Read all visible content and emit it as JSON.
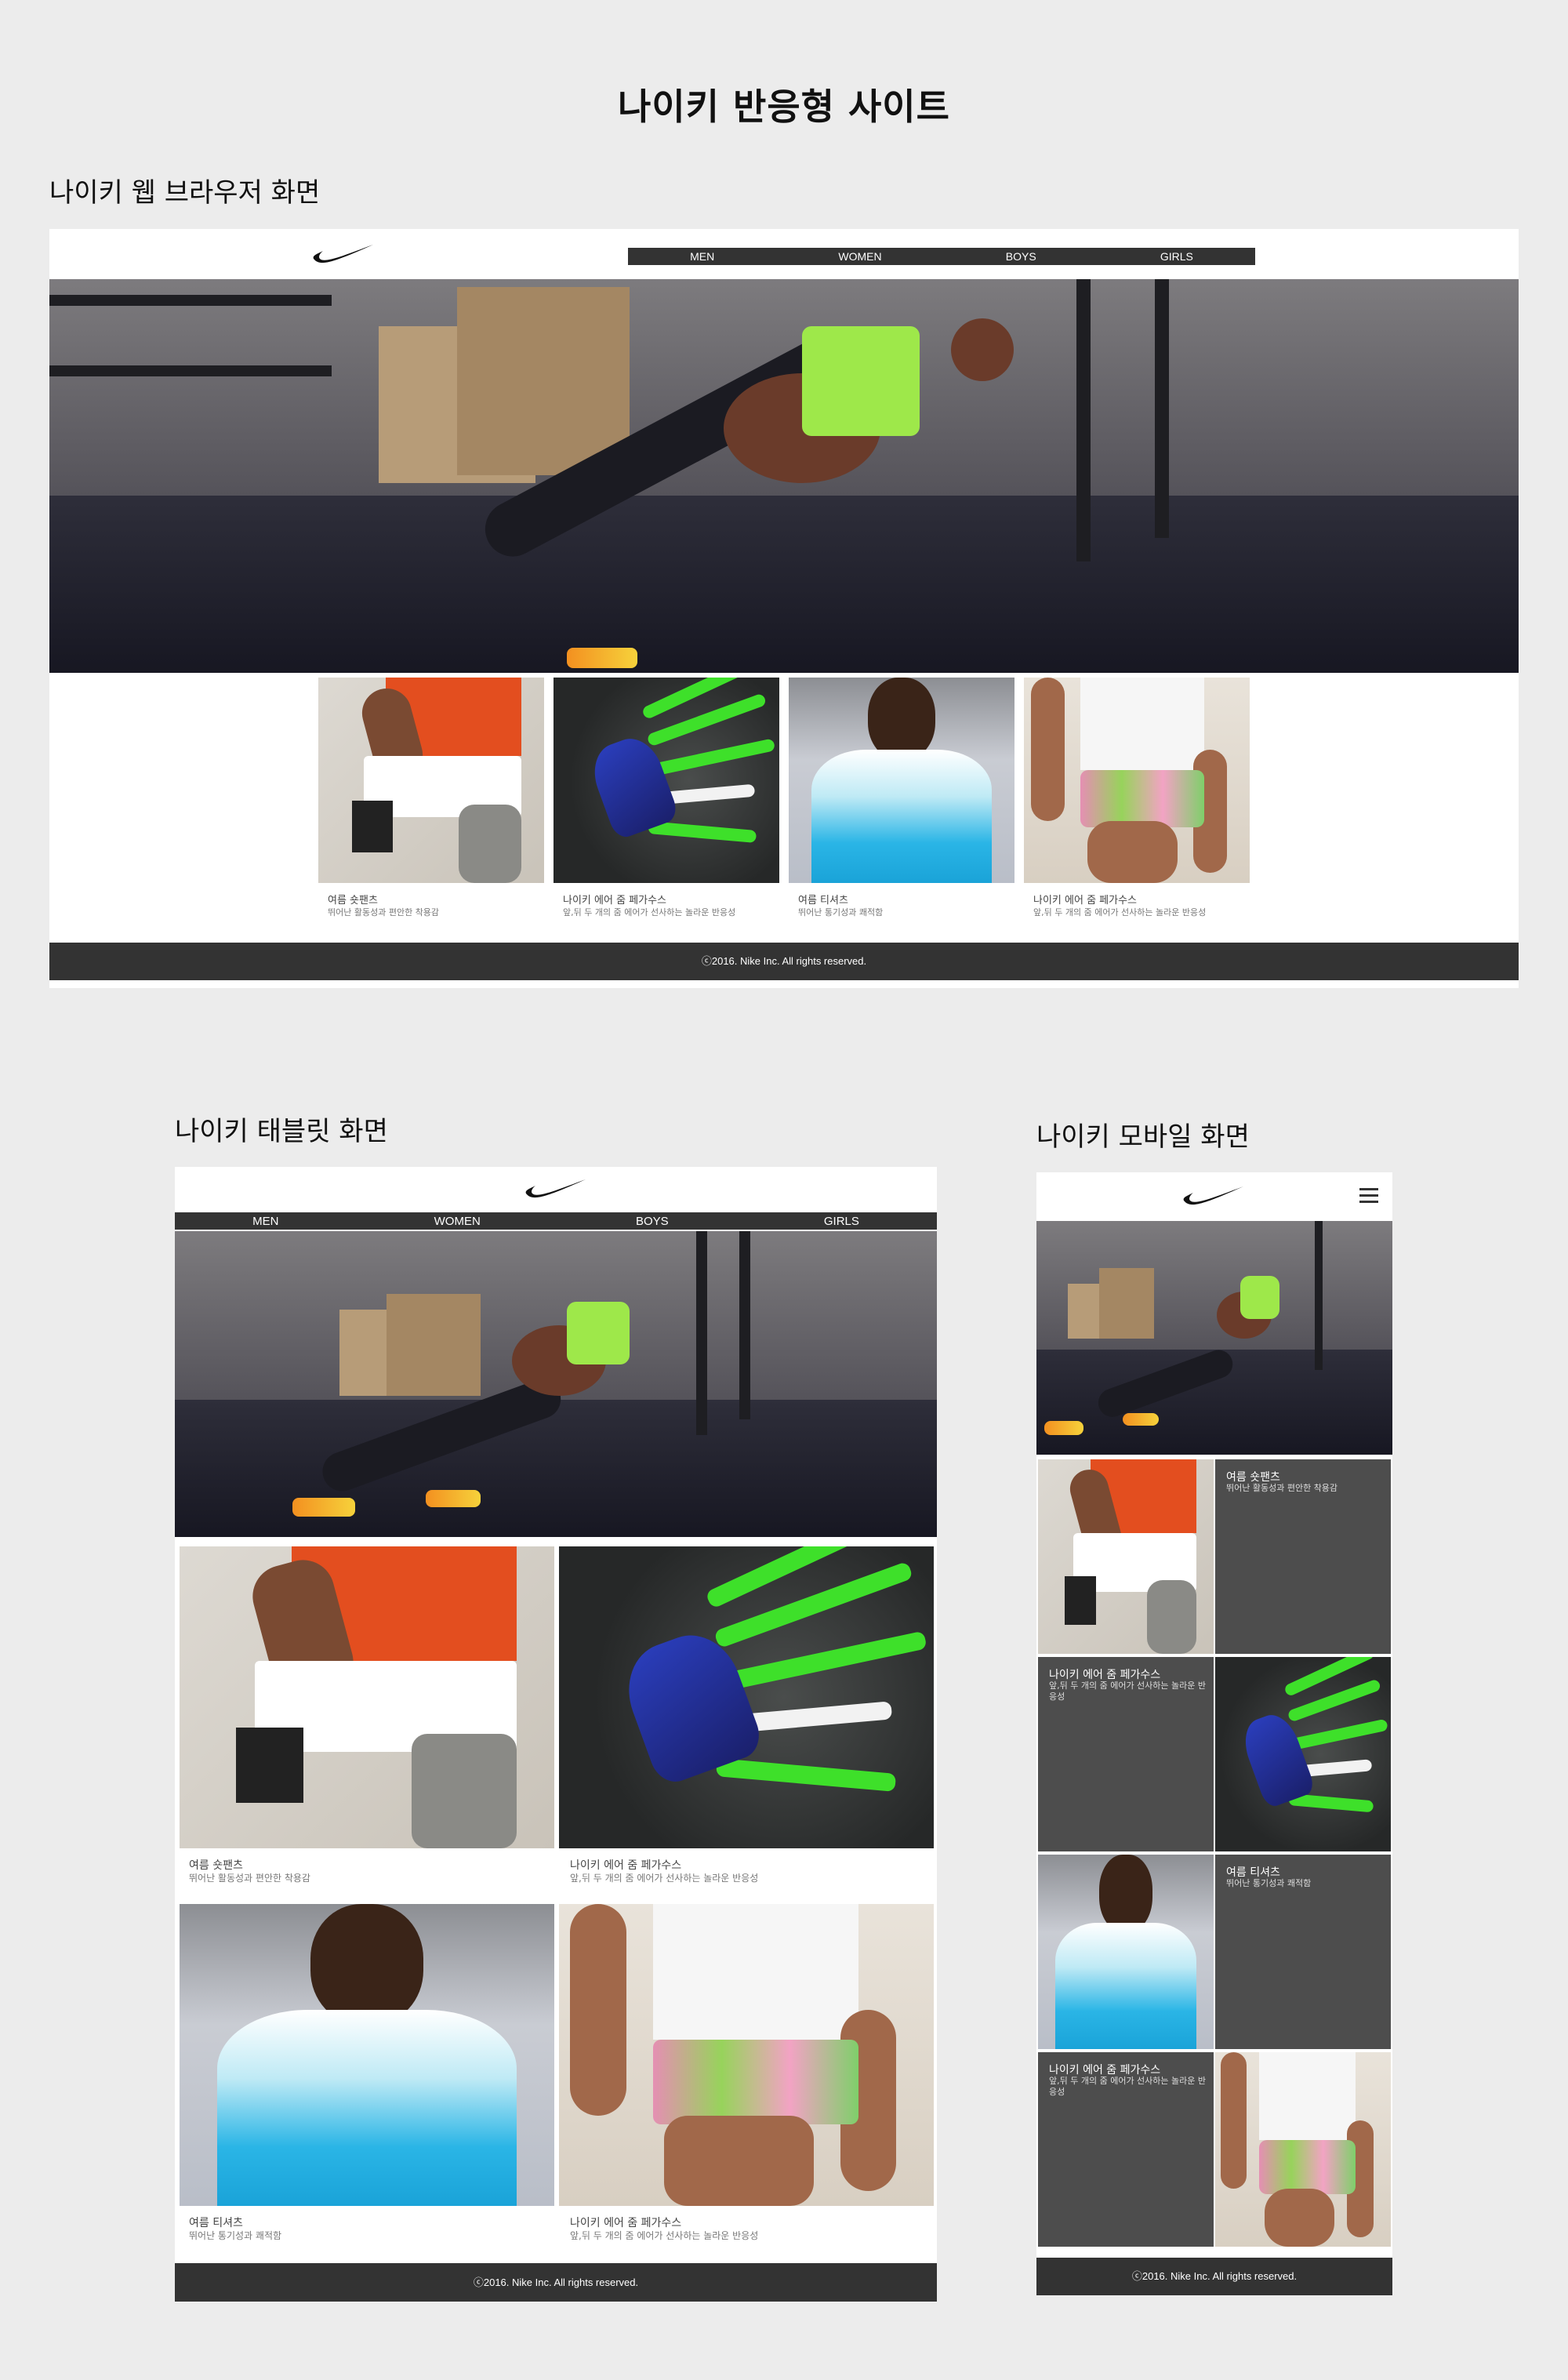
{
  "page": {
    "title": "나이키 반응형 사이트"
  },
  "sections": {
    "desktop_label": "나이키 웹 브라우저 화면",
    "tablet_label": "나이키 태블릿 화면",
    "mobile_label": "나이키 모바일 화면"
  },
  "nav": {
    "items": [
      "MEN",
      "WOMEN",
      "BOYS",
      "GIRLS"
    ]
  },
  "products": [
    {
      "title": "여름 숏팬츠",
      "desc": "뛰어난 활동성과 편안한 착용감"
    },
    {
      "title": "나이키 에어 줌 페가수스",
      "desc": "앞,뒤 두 개의 줌 에어가 선사하는 놀라운 반응성"
    },
    {
      "title": "여름 티셔츠",
      "desc": "뛰어난 통기성과 쾌적함"
    },
    {
      "title": "나이키 에어 줌 페가수스",
      "desc": "앞,뒤 두 개의 줌 에어가 선사하는 놀라운 반응성"
    }
  ],
  "footer": {
    "text": "ⓒ2016. Nike Inc. All rights reserved."
  },
  "icons": {
    "logo": "nike-swoosh-icon",
    "menu": "hamburger-menu-icon"
  },
  "colors": {
    "nav_bg": "#333333",
    "panel_bg": "#4d4d4d",
    "page_bg": "#ececec"
  }
}
